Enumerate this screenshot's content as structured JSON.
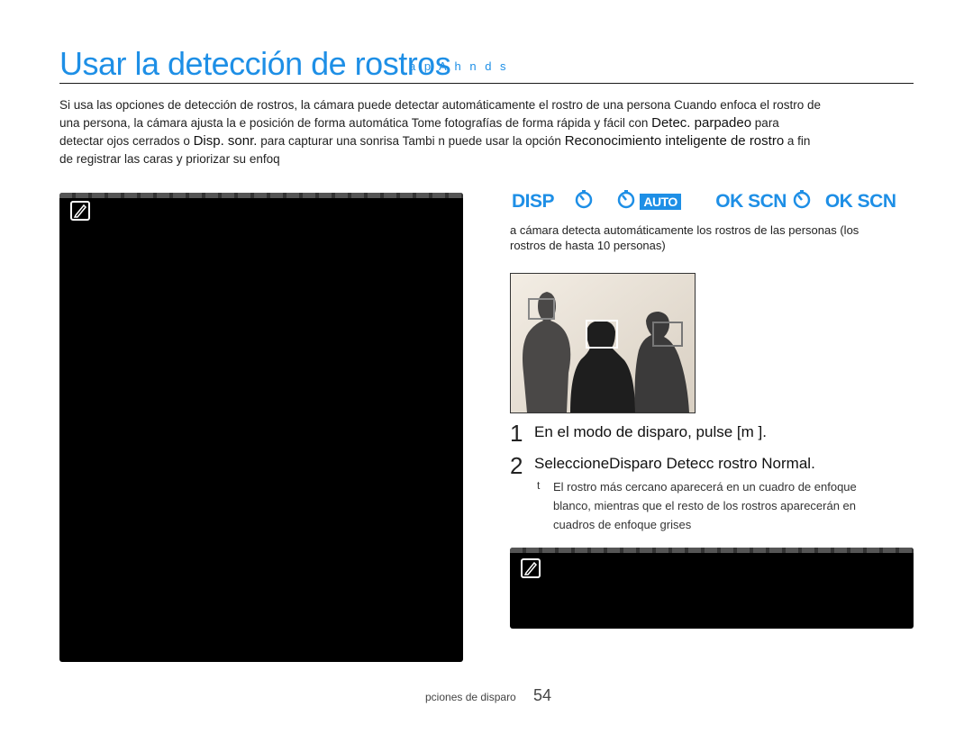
{
  "header": {
    "title": "Usar la detección de rostros",
    "modes_text": "a p A h n d s"
  },
  "intro": {
    "seg1": "Si usa las opciones de detección de rostros, la cámara puede detectar automáticamente el rostro de una persona  Cuando enfoca el rostro de una persona, la cámara ajusta la e posición de forma automática  Tome fotografías de forma rápida y fácil con ",
    "kw1": "Detec. parpadeo",
    "seg2": " para detectar ojos cerrados o ",
    "kw2": "Disp. sonr.",
    "seg3": " para capturar una sonrisa  Tambi n puede usar la opción ",
    "kw3": "Reconocimiento inteligente de rostro",
    "seg4": " a fin de registrar las caras y priorizar su enfoq"
  },
  "mode_bar": {
    "m1": "DISP",
    "m2": "AUTO",
    "m3": "OK SCN",
    "m4": "OK SCN",
    "color": "#1e8fe6"
  },
  "description": "a cámara detecta automáticamente los rostros de las personas (los rostros de hasta 10 personas)",
  "steps": [
    {
      "num": "1",
      "text": "En el modo de disparo, pulse [m        ]."
    },
    {
      "num": "2",
      "text": "SeleccioneDisparo     Detecc rostro     Normal."
    }
  ],
  "bullet": {
    "mark": "t",
    "text": "El rostro más cercano aparecerá en un cuadro de enfoque blanco, mientras que el resto de los rostros aparecerán en cuadros de enfoque grises"
  },
  "footer": {
    "label": "pciones de disparo",
    "page": "54"
  }
}
